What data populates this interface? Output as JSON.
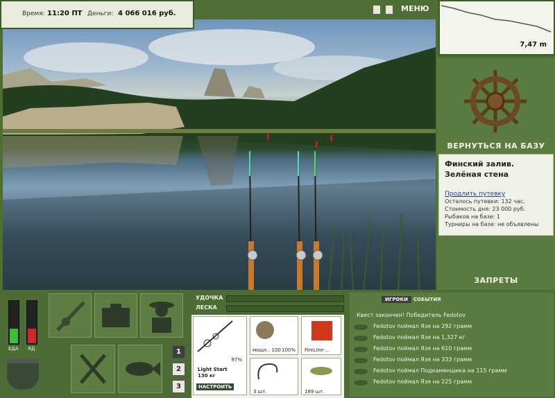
{
  "status": {
    "time_label": "Время:",
    "time_value": "11:20 ПТ",
    "money_label": "Деньги:",
    "money_value": "4 066 016 руб."
  },
  "header": {
    "menu_label": "МЕНЮ",
    "depth_value": "7,47 m"
  },
  "base": {
    "return_label": "ВЕРНУТЬСЯ НА БАЗУ",
    "location_title": "Финский залив. Зелёная стена",
    "extend_link": "Продлить путевку",
    "remaining": "Осталось путевки: 132 час.",
    "day_cost": "Стоимость дня: 23 000 руб.",
    "anglers": "Рыбаков на базе: 1",
    "tournaments": "Турниры на базе: не объявлены",
    "bans_label": "ЗАПРЕТЫ"
  },
  "meters": {
    "food_label": "ЕДА",
    "poison_label": "ЯД",
    "food_level": 0.35,
    "poison_level": 0.35
  },
  "tension": {
    "rod_label": "УДОЧКА",
    "line_label": "ЛЕСКА"
  },
  "tackle": {
    "rod_percent": "97%",
    "rod_name": "Light Start",
    "rod_load": "130 кг",
    "setup_button": "НАСТРОИТЬ",
    "reel_power": "мощн.: 100",
    "reel_percent": "100%",
    "line_name": "FireLine-...",
    "hooks_count": "3 шт.",
    "bait_count": "189 шт."
  },
  "pages": [
    "1",
    "2",
    "3"
  ],
  "events": {
    "tab_players": "ИГРОКИ",
    "tab_events": "СОБЫТИЯ",
    "quest": "Квест закончен! Победитель Fedotov",
    "items": [
      "Fedotov поймал Язя на 292 грамм",
      "Fedotov поймал Язя на 1,327 кг",
      "Fedotov поймал Язя на 610 грамм",
      "Fedotov поймал Язя на 333 грамм",
      "Fedotov поймал Подкаменщика на 115 грамм",
      "Fedotov поймал Язя на 225 грамм"
    ]
  }
}
